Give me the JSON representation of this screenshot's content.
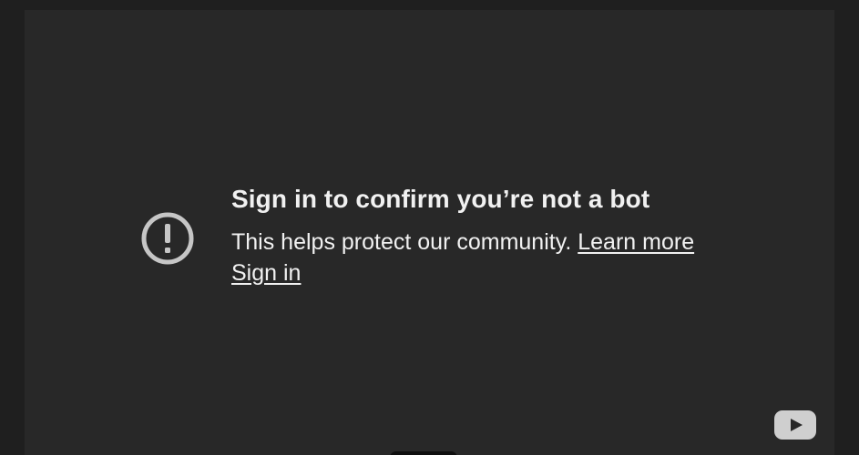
{
  "error": {
    "title": "Sign in to confirm you’re not a bot",
    "subtitle": "This helps protect our community.",
    "learn_more_label": "Learn more",
    "sign_in_label": "Sign in",
    "icon": "alert-circle-icon"
  },
  "player": {
    "logo_icon": "youtube-logo-icon"
  },
  "colors": {
    "page_background": "#1f1f1f",
    "frame_background": "#282828",
    "text": "#f1f1f1",
    "icon": "#c6c6c6"
  }
}
